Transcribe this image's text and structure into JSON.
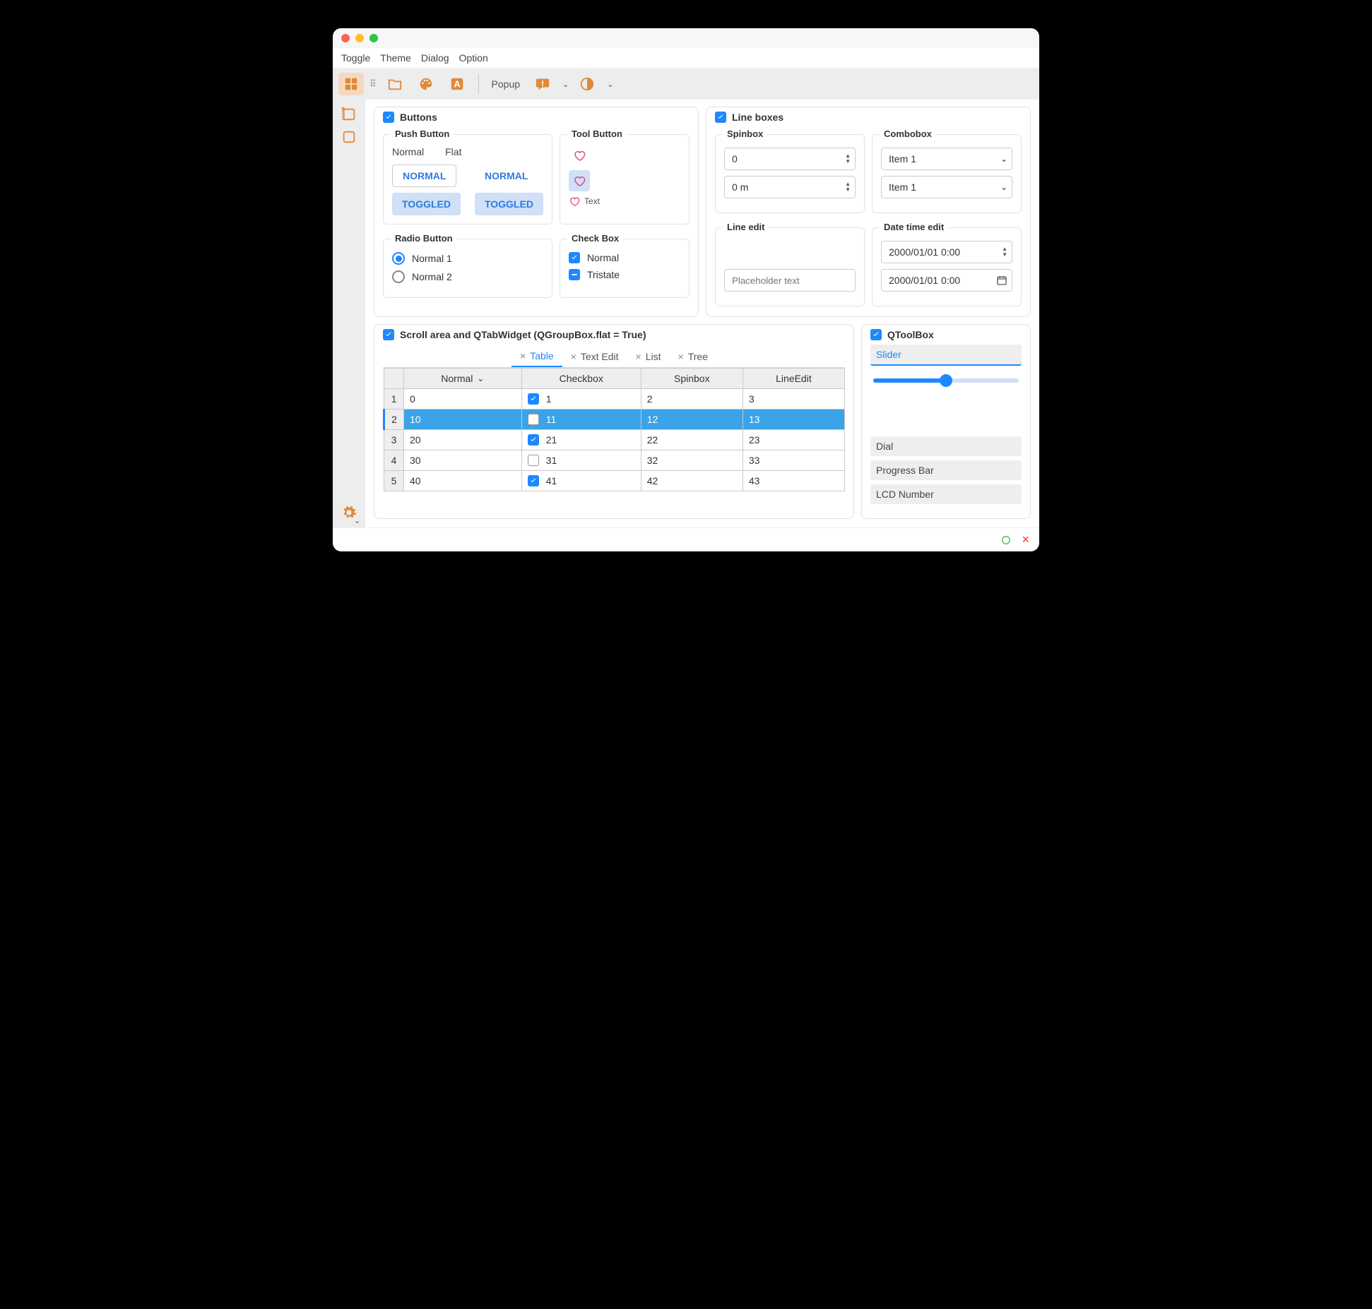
{
  "menu": {
    "toggle": "Toggle",
    "theme": "Theme",
    "dialog": "Dialog",
    "option": "Option"
  },
  "toolbar": {
    "popup": "Popup"
  },
  "buttons": {
    "title": "Buttons",
    "push": {
      "title": "Push Button",
      "normal": "Normal",
      "flat": "Flat",
      "normal_btn": "NORMAL",
      "toggled_btn": "TOGGLED"
    },
    "tool": {
      "title": "Tool Button",
      "text": "Text"
    },
    "radio": {
      "title": "Radio Button",
      "r1": "Normal 1",
      "r2": "Normal 2"
    },
    "check": {
      "title": "Check Box",
      "normal": "Normal",
      "tristate": "Tristate"
    }
  },
  "lineboxes": {
    "title": "Line boxes",
    "spin": {
      "title": "Spinbox",
      "v1": "0",
      "v2": "0 m"
    },
    "combo": {
      "title": "Combobox",
      "v1": "Item 1",
      "v2": "Item 1"
    },
    "lineedit": {
      "title": "Line edit",
      "placeholder": "Placeholder text"
    },
    "dt": {
      "title": "Date time edit",
      "v1": "2000/01/01 0:00",
      "v2": "2000/01/01 0:00"
    }
  },
  "scroll": {
    "title": "Scroll area and QTabWidget (QGroupBox.flat = True)",
    "tabs": {
      "table": "Table",
      "text": "Text Edit",
      "list": "List",
      "tree": "Tree"
    },
    "headers": {
      "normal": "Normal",
      "checkbox": "Checkbox",
      "spinbox": "Spinbox",
      "lineedit": "LineEdit"
    },
    "rows": [
      {
        "n": "1",
        "c0": "0",
        "chk": true,
        "c1": "1",
        "c2": "2",
        "c3": "3"
      },
      {
        "n": "2",
        "c0": "10",
        "chk": false,
        "c1": "11",
        "c2": "12",
        "c3": "13"
      },
      {
        "n": "3",
        "c0": "20",
        "chk": true,
        "c1": "21",
        "c2": "22",
        "c3": "23"
      },
      {
        "n": "4",
        "c0": "30",
        "chk": false,
        "c1": "31",
        "c2": "32",
        "c3": "33"
      },
      {
        "n": "5",
        "c0": "40",
        "chk": true,
        "c1": "41",
        "c2": "42",
        "c3": "43"
      }
    ]
  },
  "toolbox": {
    "title": "QToolBox",
    "slider": "Slider",
    "dial": "Dial",
    "progress": "Progress Bar",
    "lcd": "LCD Number",
    "slider_value": 50
  }
}
